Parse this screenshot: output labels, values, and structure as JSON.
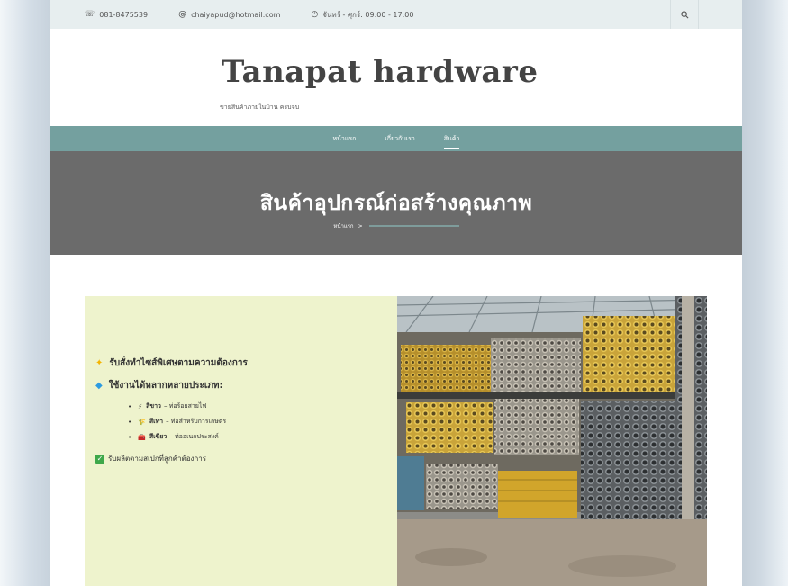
{
  "topbar": {
    "phone": "081-8475539",
    "email": "chaiyapud@hotmail.com",
    "hours": "จันทร์ - ศุกร์: 09:00 - 17:00",
    "icons": {
      "phone": "phone-icon",
      "email": "at-icon",
      "hours": "clock-icon",
      "search": "search-icon"
    }
  },
  "header": {
    "site_title": "Tanapat hardware",
    "tagline": "ขายสินค้าภายในบ้าน ครบจบ"
  },
  "nav": {
    "items": [
      {
        "label": "หน้าแรก",
        "active": false
      },
      {
        "label": "เกี่ยวกับเรา",
        "active": false
      },
      {
        "label": "สินค้า",
        "active": true
      }
    ]
  },
  "hero": {
    "title": "สินค้าอุปกรณ์ก่อสร้างคุณภาพ",
    "breadcrumb": {
      "home": "หน้าแรก",
      "separator": ">"
    }
  },
  "features": {
    "line1": "รับสั่งทำไซส์พิเศษตามความต้องการ",
    "line2": "ใช้งานได้หลากหลายประเภท:",
    "subs": [
      {
        "emoji": "⚡",
        "color_name": "สีขาว",
        "desc": "– ท่อร้อยสายไฟ"
      },
      {
        "emoji": "🌾",
        "color_name": "สีเทา",
        "desc": "– ท่อสำหรับการเกษตร"
      },
      {
        "emoji": "🧰",
        "color_name": "สีเขียว",
        "desc": "– ท่ออเนกประสงค์"
      }
    ],
    "line3": "รับผลิตตามสเปกที่ลูกค้าต้องการ"
  },
  "colors": {
    "nav_bg": "#74a09f",
    "hero_bg": "#6b6b6b",
    "topbar_bg": "#e7eeef",
    "panel_bg": "#eef3cd",
    "title_color": "#444444"
  }
}
